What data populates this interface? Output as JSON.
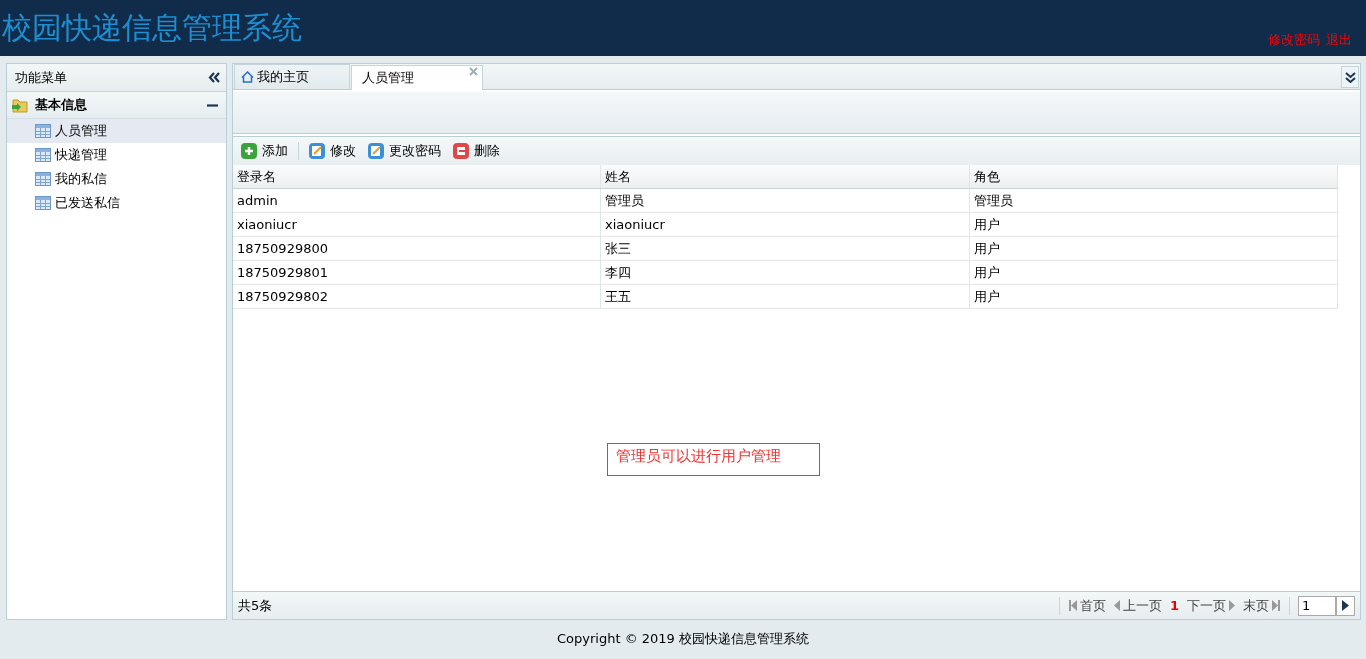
{
  "header": {
    "title": "校园快递信息管理系统",
    "links": [
      "修改密码",
      "退出"
    ]
  },
  "sidebar": {
    "title": "功能菜单",
    "group": {
      "label": "基本信息",
      "expanded": true,
      "items": [
        {
          "label": "人员管理",
          "selected": true
        },
        {
          "label": "快递管理",
          "selected": false
        },
        {
          "label": "我的私信",
          "selected": false
        },
        {
          "label": "已发送私信",
          "selected": false
        }
      ]
    }
  },
  "tabs": [
    {
      "label": "我的主页",
      "kind": "home",
      "selected": false
    },
    {
      "label": "人员管理",
      "kind": "closable",
      "selected": true
    }
  ],
  "toolbar": [
    {
      "label": "添加",
      "kind": "add"
    },
    {
      "label": "修改",
      "kind": "edit"
    },
    {
      "label": "更改密码",
      "kind": "edit"
    },
    {
      "label": "删除",
      "kind": "delete"
    }
  ],
  "table": {
    "columns": [
      "登录名",
      "姓名",
      "角色"
    ],
    "rows": [
      [
        "admin",
        "管理员",
        "管理员"
      ],
      [
        "xiaoniucr",
        "xiaoniucr",
        "用户"
      ],
      [
        "18750929800",
        "张三",
        "用户"
      ],
      [
        "18750929801",
        "李四",
        "用户"
      ],
      [
        "18750929802",
        "王五",
        "用户"
      ]
    ]
  },
  "note": "管理员可以进行用户管理",
  "pager": {
    "total": "共5条",
    "first": "首页",
    "prev": "上一页",
    "current": "1",
    "next": "下一页",
    "last": "末页",
    "page_input": "1"
  },
  "footer": "Copyright © 2019 校园快递信息管理系统"
}
